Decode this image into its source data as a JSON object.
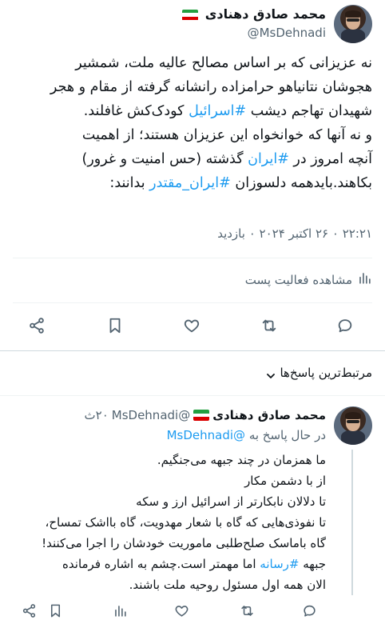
{
  "tweet": {
    "author_name": "محمد صادق دهنادی",
    "author_handle": "@MsDehnadi",
    "flag_colors": [
      "#239f40",
      "#ffffff",
      "#da0000"
    ],
    "lines": [
      "نه عزیزانی که بر اساس مصالح عالیه ملت، شمشیر",
      "هجوشان نتانیاهو حرامزاده رانشانه گرفته از مقام و هجر",
      "و نه آنها که خوانخواه این عزیزان هستند؛ از اهمیت"
    ],
    "line3_before": "شهیدان تهاجم دیشب ",
    "hashtag_israel": "#اسرائیل",
    "line3_after": " کودک‌کش غافلند.",
    "line5_before": "آنچه امروز در ",
    "hashtag_iran": "#ایران",
    "line5_after": " گذشته (حس امنیت و غرور)",
    "line6_before": "بکاهند.بایدهمه دلسوزان ",
    "hashtag_strong_iran": "#ایران_مقتدر",
    "line6_after": " بدانند:",
    "timestamp": "۲۲:۲۱ ۰ ۲۶ اکتبر ۲۰۲۴ ۰ بازدید",
    "view_activity": "مشاهده فعالیت پست"
  },
  "replies_header": "مرتبط‌ترین پاسخ‌ها",
  "reply": {
    "author_name": "محمد صادق دهنادی",
    "author_handle": "@MsDehnadi",
    "time": "۲۰ث",
    "replying_to_label": "در حال پاسخ به",
    "replying_to_handle": "@MsDehnadi",
    "lines": [
      "ما همزمان در چند جبهه می‌جنگیم.",
      "از با دشمن مکار",
      "تا دلالان نابکارتر از اسرائیل ارز و سکه",
      "تا نفوذی‌هایی که گاه با شعار مهدویت، گاه بااشک تمساح،",
      "گاه باماسک صلح‌طلبی ماموریت خودشان را اجرا می‌کنند!",
      "الان همه اول مسئول روحیه ملت باشند."
    ],
    "line6_before": "جبهه ",
    "hashtag_media": "#رسانه",
    "line6_after": " اما مهمتر است.چشم به اشاره فرمانده"
  },
  "colors": {
    "accent": "#1d9bf0",
    "muted": "#536471",
    "text": "#0f1419"
  }
}
